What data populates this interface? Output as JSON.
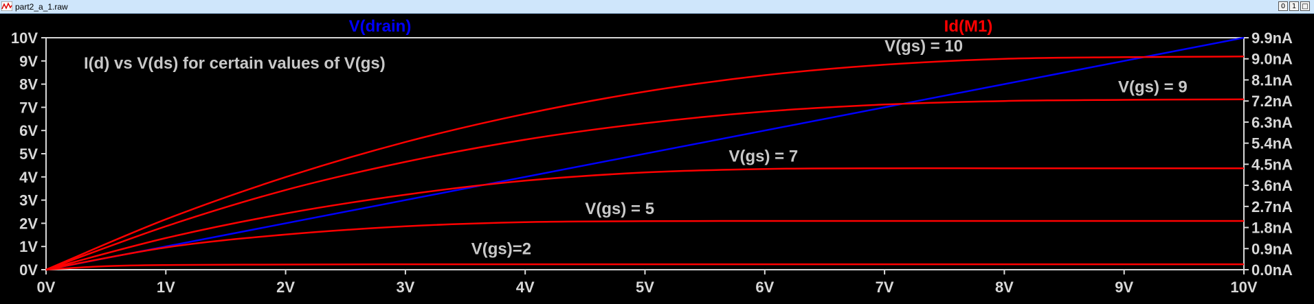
{
  "window": {
    "title": "part2_a_1.raw",
    "buttons": [
      "0",
      "1",
      "□"
    ]
  },
  "chart_data": {
    "type": "line",
    "title": "I(d) vs V(ds) for certain values of V(gs)",
    "traces": {
      "left": "V(drain)",
      "right": "Id(M1)"
    },
    "colors": {
      "voltage": "#0000ff",
      "current": "#ff0000",
      "axis": "#d8d8d8",
      "background": "#000000"
    },
    "xlim": [
      0,
      10
    ],
    "ylim_left": [
      0,
      10
    ],
    "ylim_right": [
      0,
      9.9
    ],
    "x_ticks": [
      "0V",
      "1V",
      "2V",
      "3V",
      "4V",
      "5V",
      "6V",
      "7V",
      "8V",
      "9V",
      "10V"
    ],
    "y_ticks_left": [
      "0V",
      "1V",
      "2V",
      "3V",
      "4V",
      "5V",
      "6V",
      "7V",
      "8V",
      "9V",
      "10V"
    ],
    "y_ticks_right": [
      "0.0nA",
      "0.9nA",
      "1.8nA",
      "2.7nA",
      "3.6nA",
      "4.5nA",
      "5.4nA",
      "6.3nA",
      "7.2nA",
      "8.1nA",
      "9.0nA",
      "9.9nA"
    ],
    "grid": false,
    "series": [
      {
        "name": "V(drain)",
        "axis": "left",
        "x": [
          0,
          10
        ],
        "y": [
          0,
          10
        ]
      },
      {
        "axis": "right",
        "x": [
          0,
          1,
          2,
          3,
          4,
          5,
          6,
          7,
          8,
          9,
          10
        ],
        "y": [
          0,
          2.15,
          3.95,
          5.45,
          6.65,
          7.6,
          8.3,
          8.75,
          9.0,
          9.07,
          9.1
        ]
      },
      {
        "axis": "right",
        "x": [
          0,
          1,
          2,
          3,
          4,
          5,
          6,
          7,
          8,
          9,
          10
        ],
        "y": [
          0,
          1.85,
          3.4,
          4.6,
          5.55,
          6.25,
          6.75,
          7.05,
          7.2,
          7.25,
          7.27
        ]
      },
      {
        "axis": "right",
        "x": [
          0,
          1,
          2,
          3,
          4,
          5,
          6,
          7,
          8,
          9,
          10
        ],
        "y": [
          0,
          1.35,
          2.4,
          3.2,
          3.8,
          4.15,
          4.3,
          4.33,
          4.33,
          4.33,
          4.33
        ]
      },
      {
        "axis": "right",
        "x": [
          0,
          1,
          2,
          3,
          4,
          5,
          6,
          7,
          8,
          9,
          10
        ],
        "y": [
          0,
          0.95,
          1.5,
          1.85,
          2.03,
          2.07,
          2.08,
          2.08,
          2.08,
          2.08,
          2.08
        ]
      },
      {
        "axis": "right",
        "x": [
          0,
          0.5,
          1,
          2,
          3,
          4,
          5,
          6,
          7,
          8,
          9,
          10
        ],
        "y": [
          0,
          0.15,
          0.2,
          0.22,
          0.23,
          0.23,
          0.23,
          0.23,
          0.23,
          0.23,
          0.23,
          0.23
        ]
      }
    ],
    "annotations": [
      {
        "text": "V(gs) = 10",
        "x": 7.0,
        "y": 9.55
      },
      {
        "text": "V(gs) = 9",
        "x": 8.95,
        "y": 7.8
      },
      {
        "text": "V(gs) = 7",
        "x": 5.7,
        "y": 4.85
      },
      {
        "text": "V(gs) = 5",
        "x": 4.5,
        "y": 2.6
      },
      {
        "text": "V(gs)=2",
        "x": 3.55,
        "y": 0.9
      }
    ]
  }
}
